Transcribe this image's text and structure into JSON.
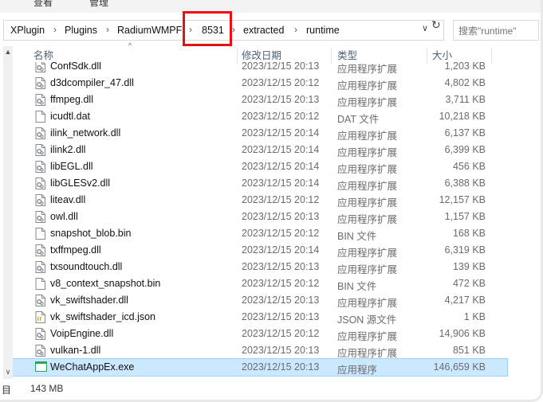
{
  "ribbon": {
    "view_label": "查看",
    "manage_label": "管理"
  },
  "breadcrumb": [
    {
      "label": "XPlugin"
    },
    {
      "label": "Plugins"
    },
    {
      "label": "RadiumWMPF"
    },
    {
      "label": "8531"
    },
    {
      "label": "extracted"
    },
    {
      "label": "runtime"
    }
  ],
  "search": {
    "placeholder": "搜索\"runtime\""
  },
  "columns": {
    "name": "名称",
    "date": "修改日期",
    "type": "类型",
    "size": "大小"
  },
  "files": [
    {
      "name": "ConfSdk.dll",
      "date": "2023/12/15 20:13",
      "type": "应用程序扩展",
      "size": "1,203 KB",
      "icon": "dll-file-icon"
    },
    {
      "name": "d3dcompiler_47.dll",
      "date": "2023/12/15 20:12",
      "type": "应用程序扩展",
      "size": "4,802 KB",
      "icon": "dll-file-icon"
    },
    {
      "name": "ffmpeg.dll",
      "date": "2023/12/15 20:13",
      "type": "应用程序扩展",
      "size": "3,711 KB",
      "icon": "dll-file-icon"
    },
    {
      "name": "icudtl.dat",
      "date": "2023/12/15 20:12",
      "type": "DAT 文件",
      "size": "10,218 KB",
      "icon": "blank-file-icon"
    },
    {
      "name": "ilink_network.dll",
      "date": "2023/12/15 20:14",
      "type": "应用程序扩展",
      "size": "6,137 KB",
      "icon": "dll-file-icon"
    },
    {
      "name": "ilink2.dll",
      "date": "2023/12/15 20:14",
      "type": "应用程序扩展",
      "size": "6,399 KB",
      "icon": "dll-file-icon"
    },
    {
      "name": "libEGL.dll",
      "date": "2023/12/15 20:14",
      "type": "应用程序扩展",
      "size": "456 KB",
      "icon": "dll-file-icon"
    },
    {
      "name": "libGLESv2.dll",
      "date": "2023/12/15 20:14",
      "type": "应用程序扩展",
      "size": "6,388 KB",
      "icon": "dll-file-icon"
    },
    {
      "name": "liteav.dll",
      "date": "2023/12/15 20:12",
      "type": "应用程序扩展",
      "size": "12,157 KB",
      "icon": "dll-file-icon"
    },
    {
      "name": "owl.dll",
      "date": "2023/12/15 20:13",
      "type": "应用程序扩展",
      "size": "1,157 KB",
      "icon": "dll-file-icon"
    },
    {
      "name": "snapshot_blob.bin",
      "date": "2023/12/15 20:12",
      "type": "BIN 文件",
      "size": "168 KB",
      "icon": "blank-file-icon"
    },
    {
      "name": "txffmpeg.dll",
      "date": "2023/12/15 20:14",
      "type": "应用程序扩展",
      "size": "6,319 KB",
      "icon": "dll-file-icon"
    },
    {
      "name": "txsoundtouch.dll",
      "date": "2023/12/15 20:13",
      "type": "应用程序扩展",
      "size": "139 KB",
      "icon": "dll-file-icon"
    },
    {
      "name": "v8_context_snapshot.bin",
      "date": "2023/12/15 20:12",
      "type": "BIN 文件",
      "size": "472 KB",
      "icon": "blank-file-icon"
    },
    {
      "name": "vk_swiftshader.dll",
      "date": "2023/12/15 20:13",
      "type": "应用程序扩展",
      "size": "4,217 KB",
      "icon": "dll-file-icon"
    },
    {
      "name": "vk_swiftshader_icd.json",
      "date": "2023/12/15 20:13",
      "type": "JSON 源文件",
      "size": "1 KB",
      "icon": "json-file-icon"
    },
    {
      "name": "VoipEngine.dll",
      "date": "2023/12/15 20:12",
      "type": "应用程序扩展",
      "size": "14,906 KB",
      "icon": "dll-file-icon"
    },
    {
      "name": "vulkan-1.dll",
      "date": "2023/12/15 20:13",
      "type": "应用程序扩展",
      "size": "851 KB",
      "icon": "dll-file-icon"
    },
    {
      "name": "WeChatAppEx.exe",
      "date": "2023/12/15 20:13",
      "type": "应用程序",
      "size": "146,659 KB",
      "icon": "exe-file-icon",
      "selected": true
    }
  ],
  "status": {
    "item_count_fragment": "目",
    "selected_size": "143 MB"
  },
  "colors": {
    "selection": "#cce8ff",
    "highlight_box": "#e81010",
    "header_text": "#4c607a"
  }
}
